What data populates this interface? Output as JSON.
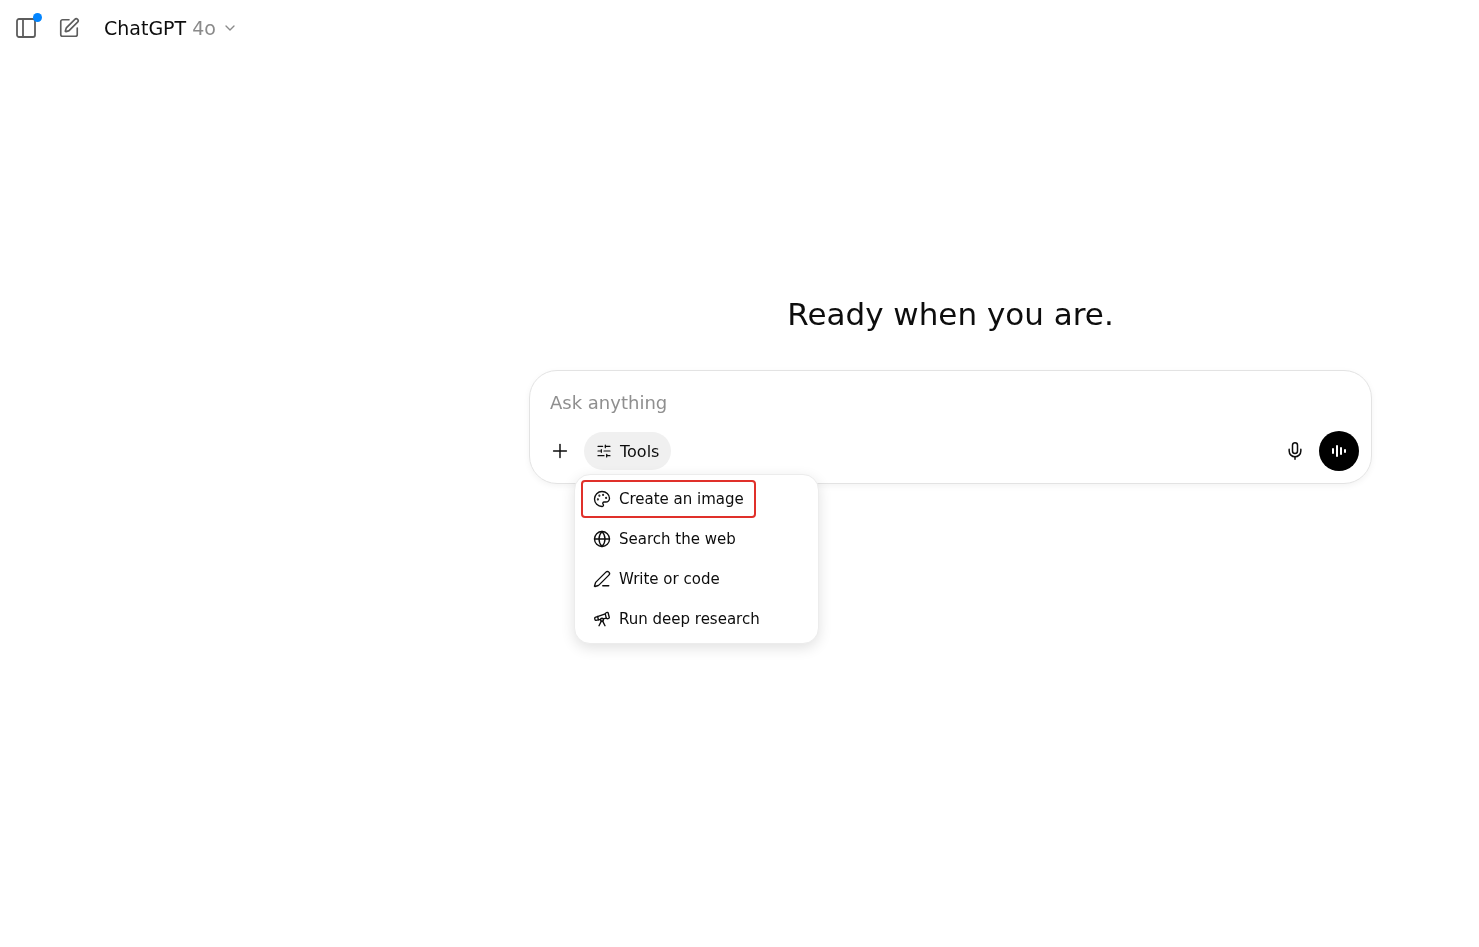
{
  "header": {
    "sidebar_badge": true,
    "model_name": "ChatGPT",
    "model_version": "4o"
  },
  "heading": "Ready when you are.",
  "composer": {
    "placeholder": "Ask anything",
    "tools_button": {
      "label": "Tools",
      "expanded": true
    }
  },
  "tools_menu": [
    {
      "kind": "image",
      "label": "Create an image",
      "highlighted": true
    },
    {
      "kind": "web",
      "label": "Search the web",
      "highlighted": false
    },
    {
      "kind": "code",
      "label": "Write or code",
      "highlighted": false
    },
    {
      "kind": "research",
      "label": "Run deep research",
      "highlighted": false
    }
  ]
}
